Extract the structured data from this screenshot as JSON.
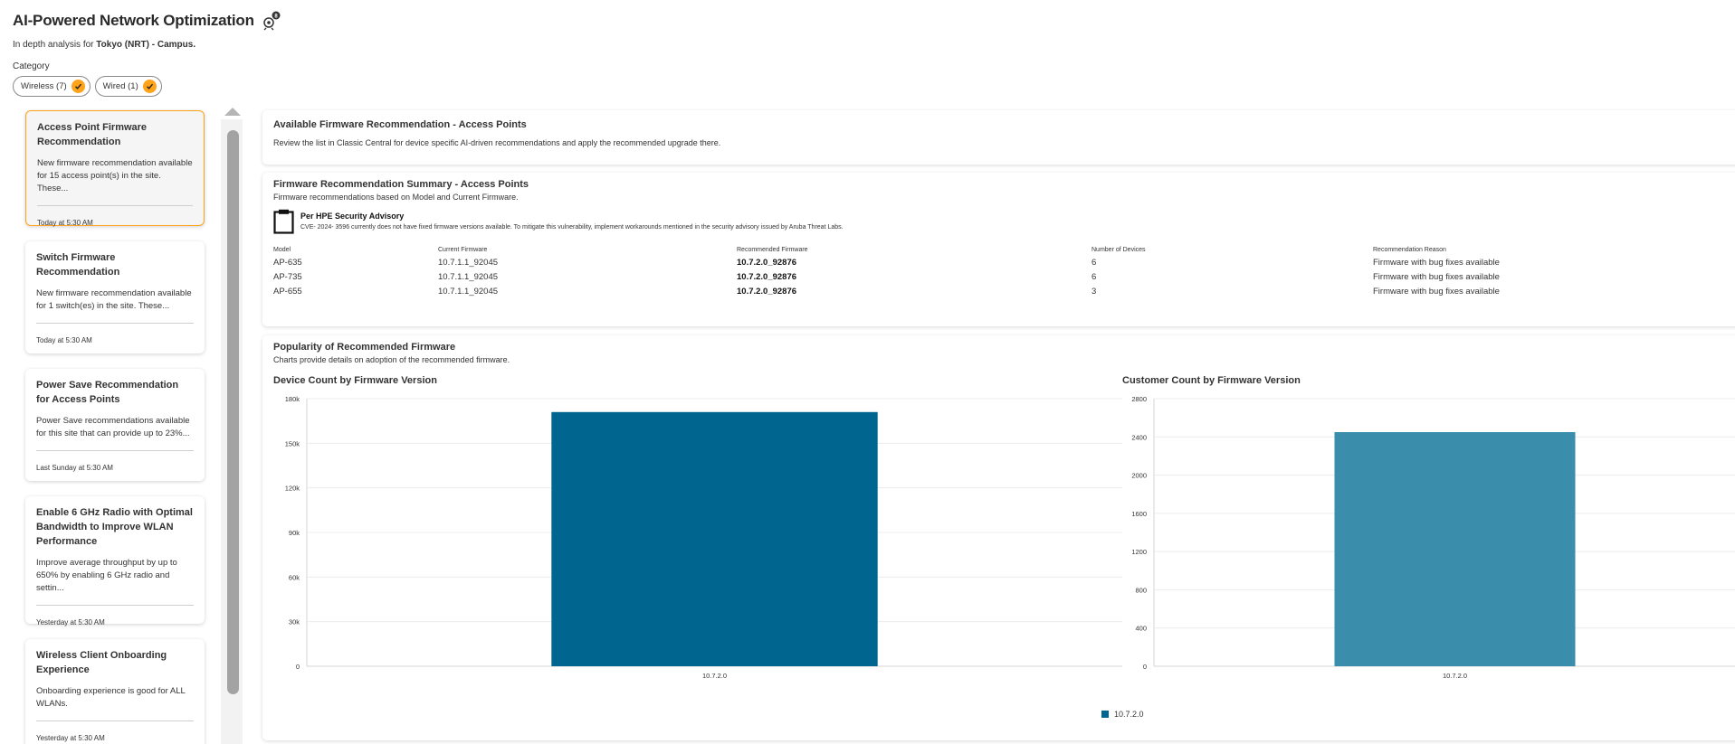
{
  "header": {
    "title": "AI-Powered Network Optimization",
    "subtitle_prefix": "In depth analysis for",
    "site_name": "Tokyo (NRT) - Campus."
  },
  "category": {
    "label": "Category",
    "chips": [
      {
        "label": "Wireless (7)"
      },
      {
        "label": "Wired (1)"
      }
    ]
  },
  "cards": [
    {
      "title": "Access Point Firmware Recommendation",
      "desc": "New firmware recommendation available for 15 access point(s) in the site. These...",
      "time": "Today at 5:30 AM"
    },
    {
      "title": "Switch Firmware Recommendation",
      "desc": "New firmware recommendation available for 1 switch(es) in the site. These...",
      "time": "Today at 5:30 AM"
    },
    {
      "title": "Power Save Recommendation for Access Points",
      "desc": "Power Save recommendations available for this site that can provide up to 23%...",
      "time": "Last Sunday at 5:30 AM"
    },
    {
      "title": "Enable 6 GHz Radio with Optimal Bandwidth to Improve WLAN Performance",
      "desc": "Improve average throughput by up to 650% by enabling 6 GHz radio and settin...",
      "time": "Yesterday at 5:30 AM"
    },
    {
      "title": "Wireless Client Onboarding Experience",
      "desc": "Onboarding experience is good for ALL WLANs.",
      "time": "Yesterday at 5:30 AM"
    }
  ],
  "panels": {
    "available": {
      "title": "Available Firmware Recommendation - Access Points",
      "text": "Review the list in Classic Central for device specific AI-driven recommendations and apply the recommended upgrade there."
    },
    "summary": {
      "title": "Firmware Recommendation Summary - Access Points",
      "subtitle": "Firmware recommendations based on Model and Current Firmware.",
      "advisory_title": "Per HPE Security Advisory",
      "advisory_text": "CVE- 2024- 3596 currently does not have fixed firmware versions available. To mitigate this vulnerability, implement workarounds mentioned in the security advisory issued by Aruba Threat Labs.",
      "columns": [
        "Model",
        "Current Firmware",
        "Recommended Firmware",
        "Number of Devices",
        "Recommendation Reason"
      ],
      "rows": [
        [
          "AP-635",
          "10.7.1.1_92045",
          "10.7.2.0_92876",
          "6",
          "Firmware with bug fixes available"
        ],
        [
          "AP-735",
          "10.7.1.1_92045",
          "10.7.2.0_92876",
          "6",
          "Firmware with bug fixes available"
        ],
        [
          "AP-655",
          "10.7.1.1_92045",
          "10.7.2.0_92876",
          "3",
          "Firmware with bug fixes available"
        ]
      ]
    },
    "popularity": {
      "title": "Popularity of Recommended Firmware",
      "subtitle": "Charts provide details on adoption of the recommended firmware."
    }
  },
  "chart_data": [
    {
      "type": "bar",
      "title": "Device Count by Firmware Version",
      "categories": [
        "10.7.2.0"
      ],
      "values": [
        171000
      ],
      "yticks": [
        "0",
        "30k",
        "60k",
        "90k",
        "120k",
        "150k",
        "180k"
      ],
      "ylim": [
        0,
        180000
      ],
      "color": "#006690",
      "grid": true
    },
    {
      "type": "bar",
      "title": "Customer Count by Firmware Version",
      "categories": [
        "10.7.2.0"
      ],
      "values": [
        2450
      ],
      "yticks": [
        "0",
        "400",
        "800",
        "1200",
        "1600",
        "2000",
        "2400",
        "2800"
      ],
      "ylim": [
        0,
        2800
      ],
      "color": "#3b8eab",
      "grid": true
    }
  ],
  "legend": {
    "label": "10.7.2.0",
    "color": "#006690"
  },
  "colors": {
    "accent": "#ffa31a"
  }
}
